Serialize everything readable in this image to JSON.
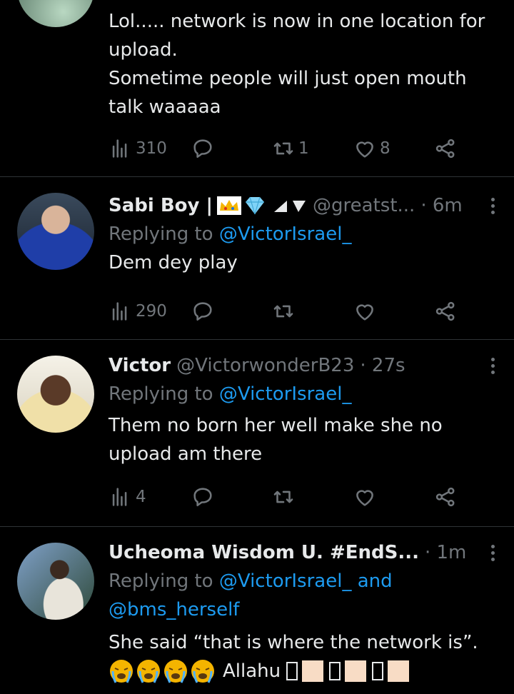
{
  "tweets": [
    {
      "lines": [
        "Lol..... network is now in one location for",
        "upload.",
        "Sometime people will just open mouth",
        "talk waaaaa"
      ],
      "views": "310",
      "retweets": "1",
      "likes": "8"
    },
    {
      "name": "Sabi Boy |",
      "handle": "@greatst...",
      "time": "· 6m",
      "replying_prefix": "Replying to ",
      "replying_to": "@VictorIsrael_",
      "lines": [
        "Dem dey play"
      ],
      "views": "290"
    },
    {
      "name": "Victor",
      "handle": "@VictorwonderB23",
      "time": "· 27s",
      "replying_prefix": "Replying to ",
      "replying_to": "@VictorIsrael_",
      "lines": [
        "Them no born her well make she no",
        "upload am there"
      ],
      "views": "4"
    },
    {
      "name": "Ucheoma Wisdom U. #EndS...",
      "time": "· 1m",
      "replying_prefix": "Replying to ",
      "replying_to": "@VictorIsrael_ and",
      "replying_to_2": "@bms_herself",
      "lines": [
        "She said “that is where the network is”."
      ],
      "trailing_text": "Allahu"
    }
  ],
  "icons": {
    "views": "views-icon",
    "reply": "reply-icon",
    "retweet": "retweet-icon",
    "like": "heart-icon",
    "share": "share-icon"
  },
  "colors": {
    "background": "#000000",
    "text": "#e7e9ea",
    "muted": "#71767b",
    "link": "#1d9bf0",
    "divider": "#2f3336"
  }
}
